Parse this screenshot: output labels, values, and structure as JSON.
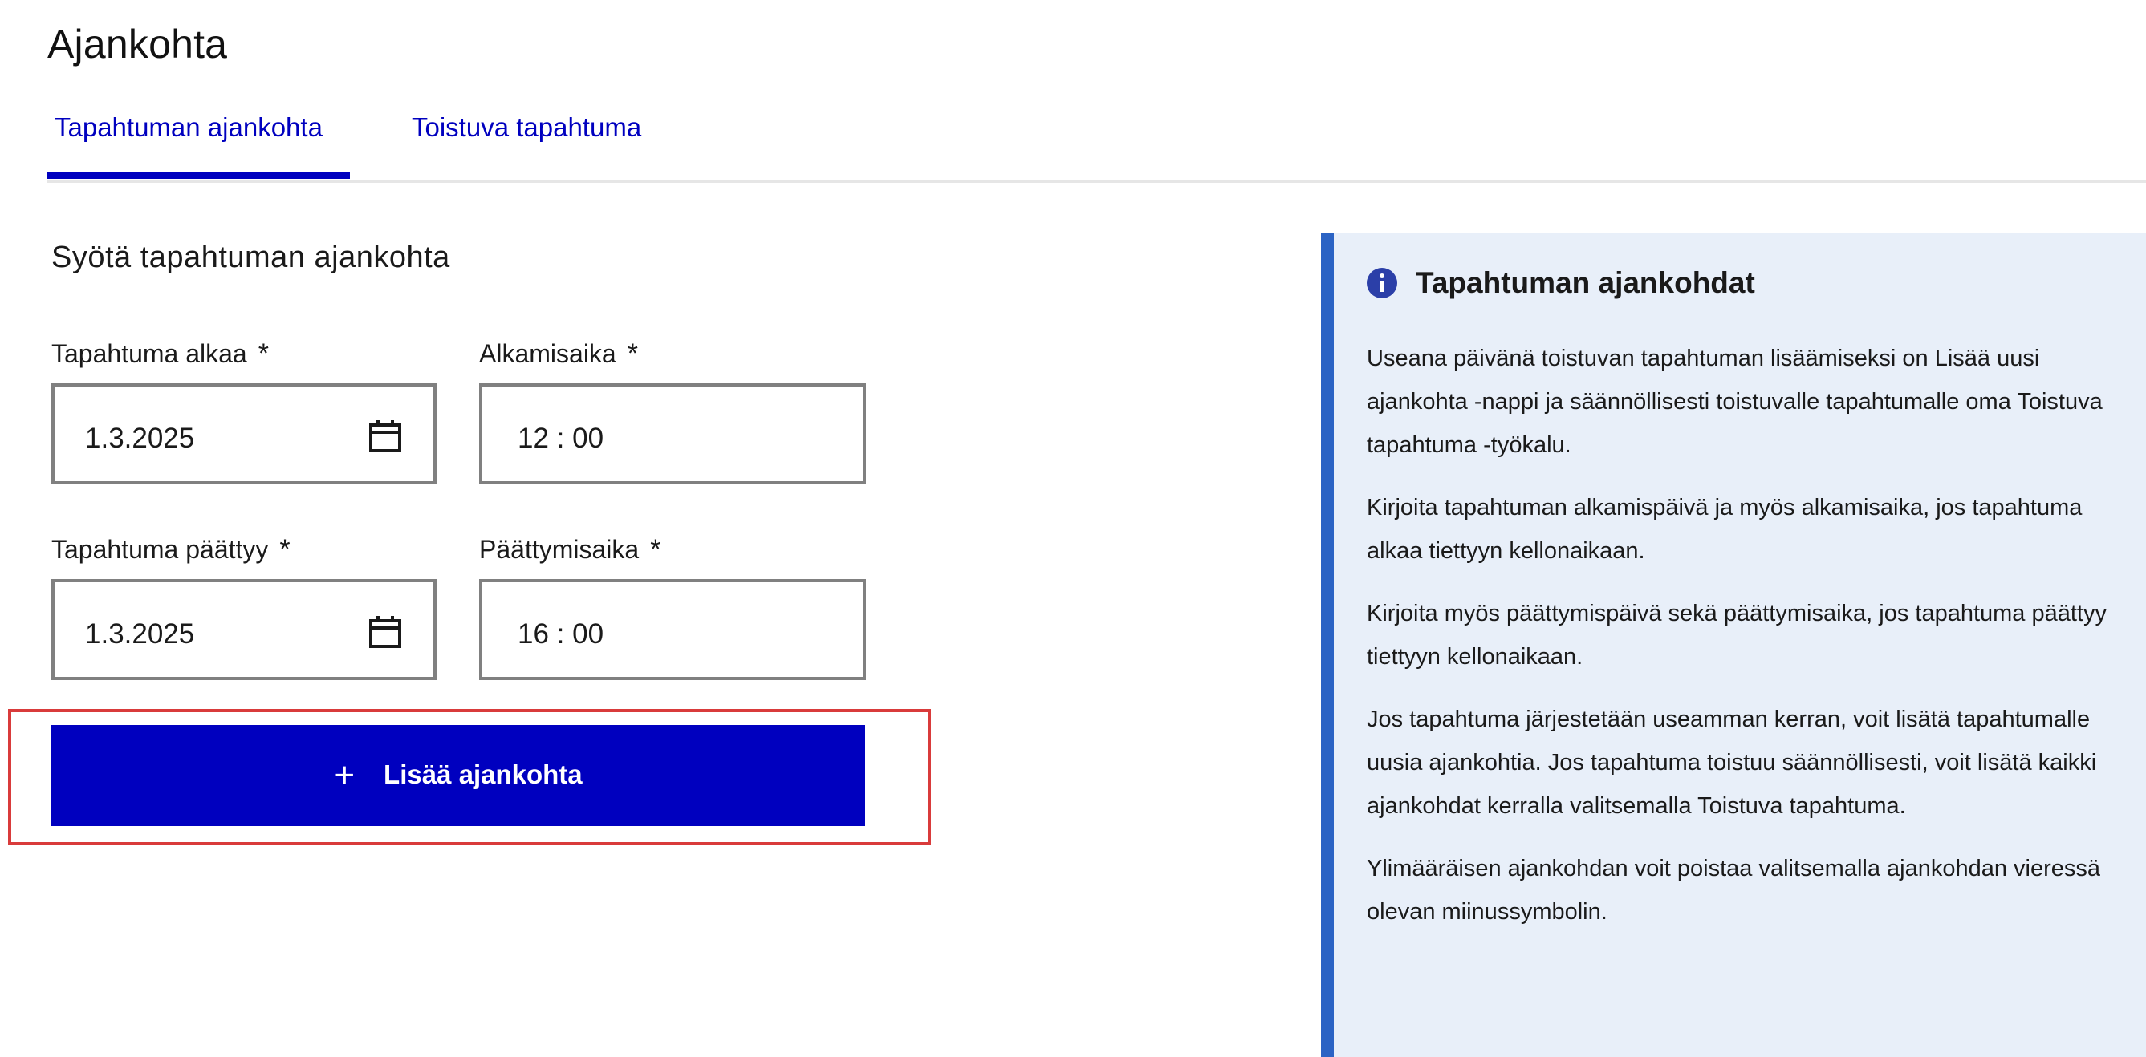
{
  "page": {
    "title": "Ajankohta"
  },
  "tabs": [
    {
      "label": "Tapahtuman ajankohta",
      "active": true
    },
    {
      "label": "Toistuva tapahtuma",
      "active": false
    }
  ],
  "form": {
    "heading": "Syötä tapahtuman ajankohta",
    "required_marker": "*",
    "start_date": {
      "label": "Tapahtuma alkaa",
      "value": "1.3.2025",
      "icon": "calendar-icon"
    },
    "start_time": {
      "label": "Alkamisaika",
      "value": "12 : 00"
    },
    "end_date": {
      "label": "Tapahtuma päättyy",
      "value": "1.3.2025",
      "icon": "calendar-icon"
    },
    "end_time": {
      "label": "Päättymisaika",
      "value": "16 : 00"
    },
    "add_button": {
      "icon": "+",
      "label": "Lisää ajankohta"
    }
  },
  "info_panel": {
    "icon": "info-icon",
    "title": "Tapahtuman ajankohdat",
    "paragraphs": [
      "Useana päivänä toistuvan tapahtuman lisäämiseksi on Lisää uusi ajankohta -nappi ja säännöllisesti toistuvalle tapahtumalle oma Toistuva tapahtuma -työkalu.",
      "Kirjoita tapahtuman alkamispäivä ja myös alkamisaika, jos tapahtuma alkaa tiettyyn kellonaikaan.",
      "Kirjoita myös päättymispäivä sekä päättymisaika, jos tapahtuma päättyy tiettyyn kellonaikaan.",
      "Jos tapahtuma järjestetään useamman kerran, voit lisätä tapahtumalle uusia ajankohtia. Jos tapahtuma toistuu säännöllisesti, voit lisätä kaikki ajankohdat kerralla valitsemalla Toistuva tapahtuma.",
      "Ylimääräisen ajankohdan voit poistaa valitsemalla ajankohdan vieressä olevan miinussymbolin."
    ],
    "accent_color": "#2b63c4",
    "background_color": "#e8eff9"
  },
  "colors": {
    "primary": "#0000bf",
    "highlight": "#d93b3b"
  }
}
